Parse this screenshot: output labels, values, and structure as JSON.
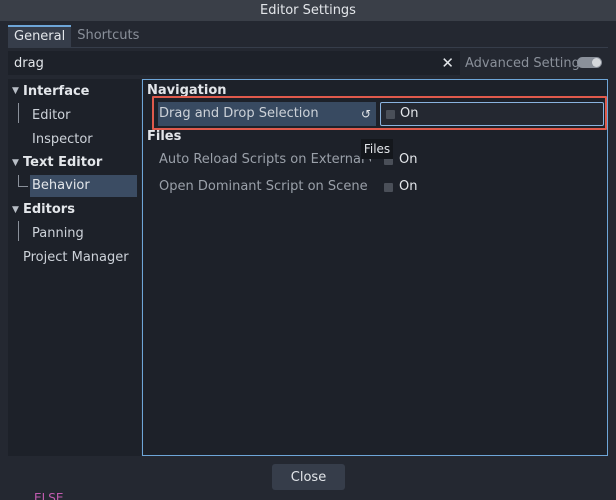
{
  "window": {
    "title": "Editor Settings"
  },
  "tabs": [
    {
      "label": "General",
      "active": true
    },
    {
      "label": "Shortcuts",
      "active": false
    }
  ],
  "search": {
    "value": "drag",
    "clear_icon": "close-icon"
  },
  "advanced": {
    "label": "Advanced Settings",
    "toggle_on": false
  },
  "sidebar": {
    "items": [
      {
        "label": "Interface",
        "bold": true,
        "expanded": true
      },
      {
        "label": "Editor",
        "bold": false
      },
      {
        "label": "Inspector",
        "bold": false
      },
      {
        "label": "Text Editor",
        "bold": true,
        "expanded": true
      },
      {
        "label": "Behavior",
        "bold": false,
        "selected": true
      },
      {
        "label": "Editors",
        "bold": true,
        "expanded": true
      },
      {
        "label": "Panning",
        "bold": false
      },
      {
        "label": "Project Manager",
        "bold": false
      }
    ]
  },
  "sections": [
    {
      "title": "Navigation",
      "properties": [
        {
          "label": "Drag and Drop Selection",
          "value": "On",
          "checked": false,
          "highlighted": true
        }
      ]
    },
    {
      "title": "Files",
      "properties": [
        {
          "label": "Auto Reload Scripts on External Chan",
          "value": "On",
          "checked": false
        },
        {
          "label": "Open Dominant Script on Scene Cha",
          "value": "On",
          "checked": false
        }
      ]
    }
  ],
  "tooltip": {
    "text": "Files"
  },
  "footer": {
    "close_label": "Close"
  },
  "background_peek": "ELSE",
  "colors": {
    "accent": "#6ea6d8",
    "highlight_outline": "#e05a4c",
    "selected": "#3b4c63"
  }
}
